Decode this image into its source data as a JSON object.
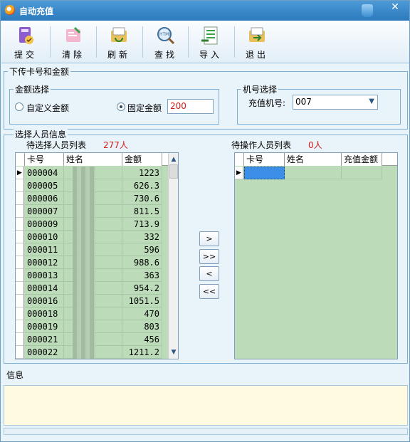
{
  "window": {
    "title": "自动充值",
    "close_glyph": "✕"
  },
  "toolbar": {
    "buttons": [
      {
        "label": "提交",
        "icon": "submit-icon"
      },
      {
        "label": "清除",
        "icon": "clear-icon"
      },
      {
        "label": "刷新",
        "icon": "refresh-icon"
      },
      {
        "label": "查找",
        "icon": "search-icon"
      },
      {
        "label": "导入",
        "icon": "import-icon"
      },
      {
        "label": "退出",
        "icon": "exit-icon"
      }
    ]
  },
  "download_group": {
    "title": "下传卡号和金额",
    "amount": {
      "title": "金额选择",
      "custom_label": "自定义金额",
      "fixed_label": "固定金额",
      "fixed_value": "200",
      "selected": "fixed"
    },
    "machine": {
      "title": "机号选择",
      "label": "充值机号:",
      "value": "007"
    }
  },
  "persons_group": {
    "title": "选择人员信息",
    "left": {
      "title": "待选择人员列表",
      "count": "277人",
      "columns": [
        "卡号",
        "姓名",
        "金额"
      ],
      "rows": [
        {
          "card": "000004",
          "amount": "1223"
        },
        {
          "card": "000005",
          "amount": "626.3"
        },
        {
          "card": "000006",
          "amount": "730.6"
        },
        {
          "card": "000007",
          "amount": "811.5"
        },
        {
          "card": "000009",
          "amount": "713.9"
        },
        {
          "card": "000010",
          "amount": "332"
        },
        {
          "card": "000011",
          "amount": "596"
        },
        {
          "card": "000012",
          "amount": "988.6"
        },
        {
          "card": "000013",
          "amount": "363"
        },
        {
          "card": "000014",
          "amount": "954.2"
        },
        {
          "card": "000016",
          "amount": "1051.5"
        },
        {
          "card": "000018",
          "amount": "470"
        },
        {
          "card": "000019",
          "amount": "803"
        },
        {
          "card": "000021",
          "amount": "456"
        },
        {
          "card": "000022",
          "amount": "1211.2"
        }
      ]
    },
    "right": {
      "title": "待操作人员列表",
      "count": "0人",
      "columns": [
        "卡号",
        "姓名",
        "充值金额"
      ]
    },
    "move_buttons": [
      ">",
      ">>",
      "<",
      "<<"
    ]
  },
  "info": {
    "label": "信息"
  },
  "colors": {
    "title_bar": "#2c79bd",
    "grid_bg": "#bcdcb9",
    "info_bg": "#fffbe0",
    "accent_red": "#d41a1a"
  }
}
